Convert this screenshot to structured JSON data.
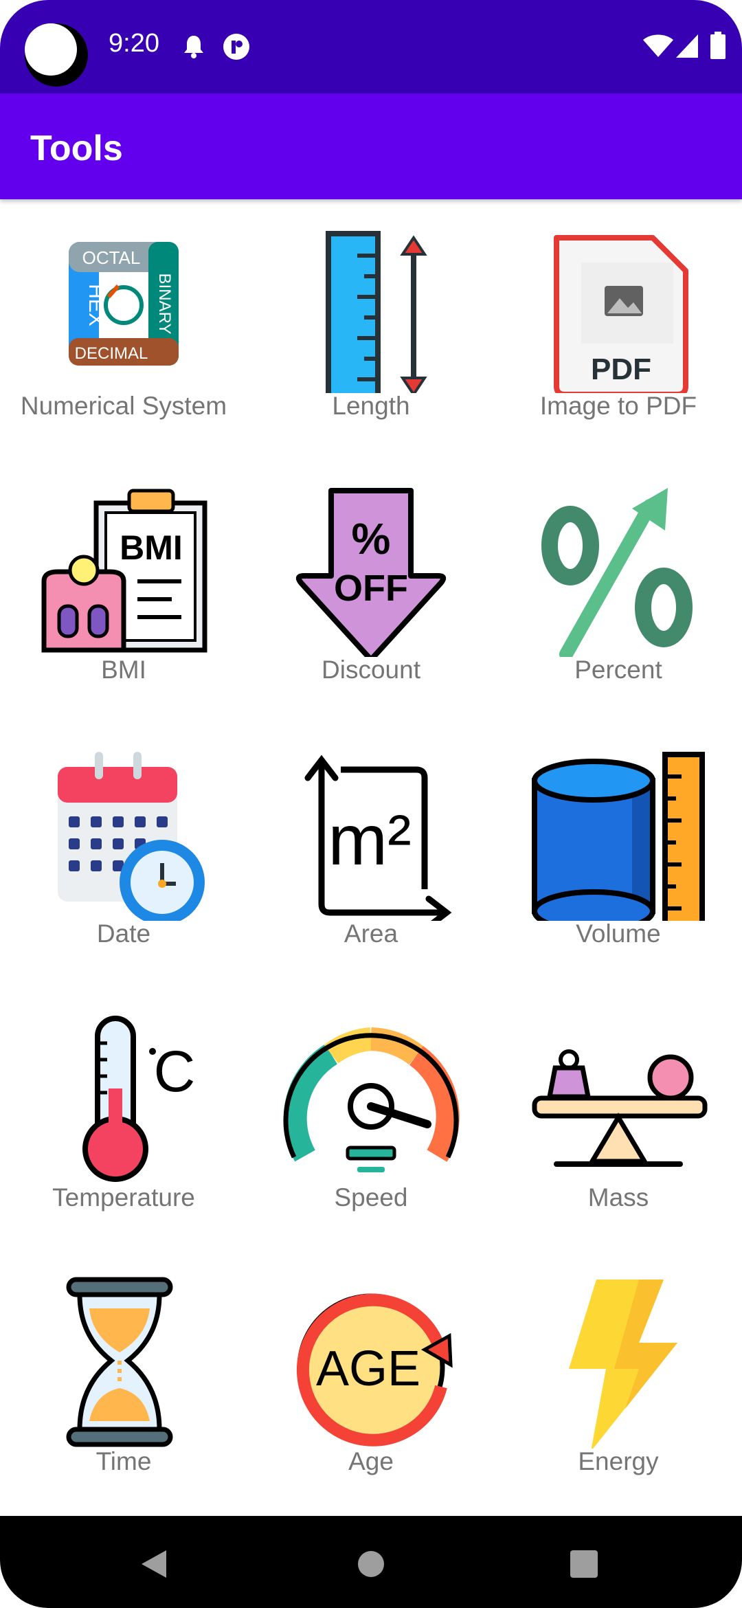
{
  "status_bar": {
    "time": "9:20",
    "icons": [
      "camera-cutout-icon",
      "notification-bell-icon",
      "app-notification-icon",
      "wifi-icon",
      "cell-signal-icon",
      "battery-icon"
    ]
  },
  "app_bar": {
    "title": "Tools"
  },
  "tools": [
    {
      "label": "Numerical System",
      "icon": "numerical-system-icon"
    },
    {
      "label": "Length",
      "icon": "ruler-icon"
    },
    {
      "label": "Image to PDF",
      "icon": "pdf-icon"
    },
    {
      "label": "BMI",
      "icon": "bmi-clipboard-icon"
    },
    {
      "label": "Discount",
      "icon": "discount-arrow-icon"
    },
    {
      "label": "Percent",
      "icon": "percent-icon"
    },
    {
      "label": "Date",
      "icon": "calendar-clock-icon"
    },
    {
      "label": "Area",
      "icon": "area-m2-icon"
    },
    {
      "label": "Volume",
      "icon": "cylinder-icon"
    },
    {
      "label": "Temperature",
      "icon": "thermometer-icon"
    },
    {
      "label": "Speed",
      "icon": "speedometer-icon"
    },
    {
      "label": "Mass",
      "icon": "scale-icon"
    },
    {
      "label": "Time",
      "icon": "hourglass-icon"
    },
    {
      "label": "Age",
      "icon": "age-icon"
    },
    {
      "label": "Energy",
      "icon": "lightning-icon"
    }
  ],
  "icon_text": {
    "octal": "OCTAL",
    "binary": "BINARY",
    "hex": "HEX",
    "decimal": "DECIMAL",
    "pdf": "PDF",
    "bmi": "BMI",
    "percent": "%",
    "off": "OFF",
    "m2": "m²",
    "celsius": "C",
    "age": "AGE"
  },
  "nav_bar": {
    "icons": [
      "back-icon",
      "home-icon",
      "recents-icon"
    ]
  },
  "colors": {
    "status_bar": "#3700b3",
    "app_bar": "#6200ee",
    "label": "#757575"
  }
}
